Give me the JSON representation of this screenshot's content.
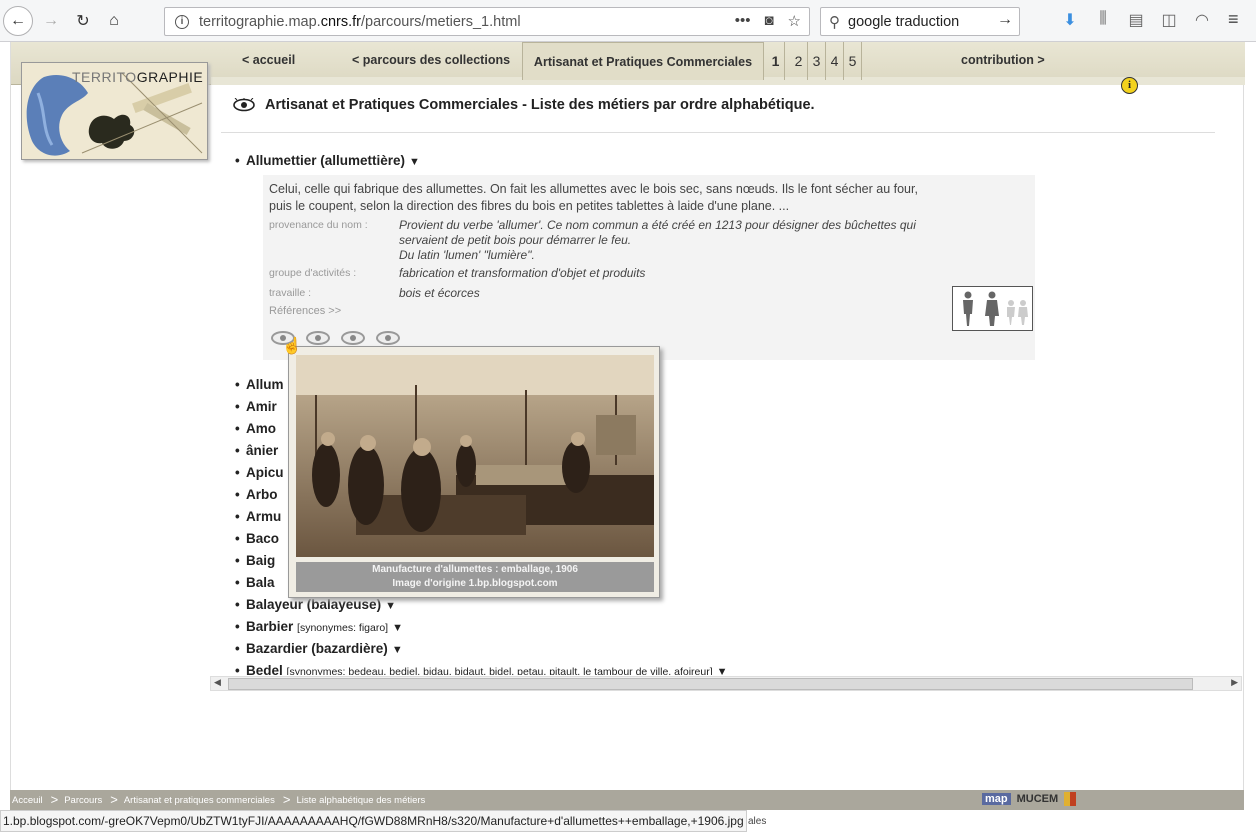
{
  "browser": {
    "url_host": "territographie.map.",
    "url_domain": "cnrs.fr",
    "url_path": "/parcours/metiers_1.html",
    "search_value": "google traduction"
  },
  "nav": {
    "accueil": "< accueil",
    "parcours": "< parcours des collections",
    "active_tab": "Artisanat et Pratiques Commerciales",
    "pages": [
      "1",
      "2",
      "3",
      "4",
      "5"
    ],
    "contribution": "contribution >"
  },
  "logo": {
    "part1": "TERRITO",
    "part2": "GRAPHIE"
  },
  "heading": "Artisanat et Pratiques Commerciales - Liste des métiers par ordre alphabétique.",
  "detail": {
    "title": "Allumettier (allumettière)",
    "description": "Celui, celle qui fabrique des allumettes. On fait les allumettes avec le bois sec, sans nœuds. Ils le font sécher au four, puis le coupent, selon la direction des fibres du bois en petites tablettes à laide d'une plane. ...",
    "provenance_label": "provenance du nom :",
    "provenance_value_1": "Provient du verbe 'allumer'. Ce nom commun a été créé en 1213 pour désigner des bûchettes qui",
    "provenance_value_2": "servaient de petit bois pour démarrer le feu.",
    "provenance_value_3": "Du latin 'lumen' \"lumière\".",
    "groupe_label": "groupe d'activités :",
    "groupe_value": "fabrication et transformation d'objet et produits",
    "travaille_label": "travaille :",
    "travaille_value": "bois et écorces",
    "references": "Références >>"
  },
  "list": [
    {
      "name": "Allum",
      "syn": "",
      "arrow": ""
    },
    {
      "name": "Amir",
      "syn": "",
      "arrow": ""
    },
    {
      "name": "Amo",
      "syn": "",
      "arrow": ""
    },
    {
      "name": "ânier",
      "syn": "",
      "arrow": ""
    },
    {
      "name": "Apicu",
      "syn": "",
      "arrow": ""
    },
    {
      "name": "Arbo",
      "syn": "",
      "arrow": ""
    },
    {
      "name": "Armu",
      "syn": "",
      "arrow": ""
    },
    {
      "name": "Baco",
      "syn": "",
      "arrow": ""
    },
    {
      "name": "Baig",
      "syn": "",
      "arrow": ""
    },
    {
      "name": "Bala",
      "syn": "",
      "arrow": ""
    },
    {
      "name": "Balayeur (balayeuse)",
      "syn": "",
      "arrow": "▼"
    },
    {
      "name": "Barbier",
      "syn": "[synonymes: figaro]",
      "arrow": "▼"
    },
    {
      "name": "Bazardier (bazardière)",
      "syn": "",
      "arrow": "▼"
    },
    {
      "name": "Bedel",
      "syn": "[synonymes: bedeau, bediel, bidau, bidaut, bidel, petau, pitault, le tambour de ville, afoireur]",
      "arrow": "▼"
    }
  ],
  "popup": {
    "caption_1": "Manufacture d'allumettes : emballage, 1906",
    "caption_2": "Image d'origine 1.bp.blogspot.com"
  },
  "footer": {
    "crumbs": [
      "Acceuil",
      "Parcours",
      "Artisanat et pratiques commerciales",
      "Liste alphabétique des métiers"
    ],
    "partner": "MUCEM",
    "partner_map": "map"
  },
  "status": {
    "url": "1.bp.blogspot.com/-greOK7Vepm0/UbZTW1tyFJI/AAAAAAAAAHQ/fGWD88MRnH8/s320/Manufacture+d'allumettes++emballage,+1906.jpg",
    "tail": "ales"
  }
}
